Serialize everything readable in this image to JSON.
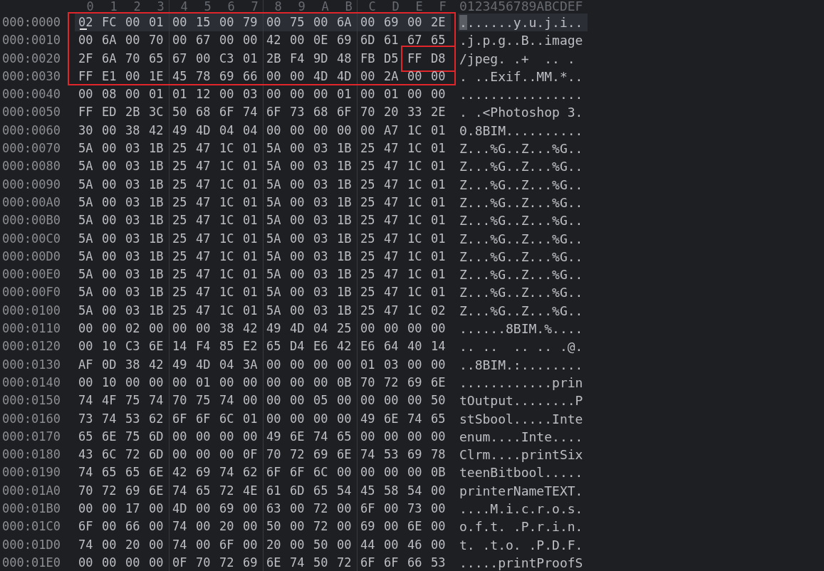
{
  "header": {
    "columns": [
      "0",
      "1",
      "2",
      "3",
      "4",
      "5",
      "6",
      "7",
      "8",
      "9",
      "A",
      "B",
      "C",
      "D",
      "E",
      "F"
    ],
    "ascii": "0123456789ABCDEF"
  },
  "rows": [
    {
      "offset": "000:0000",
      "current": true,
      "boxed": true,
      "last_pair_boxed": false,
      "bytes": [
        "02",
        "FC",
        "00",
        "01",
        "00",
        "15",
        "00",
        "79",
        "00",
        "75",
        "00",
        "6A",
        "00",
        "69",
        "00",
        "2E"
      ],
      "ascii": ".......y.u.j.i.."
    },
    {
      "offset": "000:0010",
      "current": false,
      "boxed": true,
      "last_pair_boxed": false,
      "bytes": [
        "00",
        "6A",
        "00",
        "70",
        "00",
        "67",
        "00",
        "00",
        "42",
        "00",
        "0E",
        "69",
        "6D",
        "61",
        "67",
        "65"
      ],
      "ascii": ".j.p.g..B..image"
    },
    {
      "offset": "000:0020",
      "current": false,
      "boxed": true,
      "last_pair_boxed": true,
      "bytes": [
        "2F",
        "6A",
        "70",
        "65",
        "67",
        "00",
        "C3",
        "01",
        "2B",
        "F4",
        "9D",
        "48",
        "FB",
        "D5",
        "FF",
        "D8"
      ],
      "ascii": "/jpeg. .+  .. ."
    },
    {
      "offset": "000:0030",
      "current": false,
      "boxed": true,
      "last_pair_boxed": false,
      "bytes": [
        "FF",
        "E1",
        "00",
        "1E",
        "45",
        "78",
        "69",
        "66",
        "00",
        "00",
        "4D",
        "4D",
        "00",
        "2A",
        "00",
        "00"
      ],
      "ascii": ". ..Exif..MM.*.."
    },
    {
      "offset": "000:0040",
      "current": false,
      "bytes": [
        "00",
        "08",
        "00",
        "01",
        "01",
        "12",
        "00",
        "03",
        "00",
        "00",
        "00",
        "01",
        "00",
        "01",
        "00",
        "00"
      ],
      "ascii": "................"
    },
    {
      "offset": "000:0050",
      "current": false,
      "bytes": [
        "FF",
        "ED",
        "2B",
        "3C",
        "50",
        "68",
        "6F",
        "74",
        "6F",
        "73",
        "68",
        "6F",
        "70",
        "20",
        "33",
        "2E"
      ],
      "ascii": ". .<Photoshop 3."
    },
    {
      "offset": "000:0060",
      "current": false,
      "bytes": [
        "30",
        "00",
        "38",
        "42",
        "49",
        "4D",
        "04",
        "04",
        "00",
        "00",
        "00",
        "00",
        "00",
        "A7",
        "1C",
        "01"
      ],
      "ascii": "0.8BIM.........."
    },
    {
      "offset": "000:0070",
      "current": false,
      "bytes": [
        "5A",
        "00",
        "03",
        "1B",
        "25",
        "47",
        "1C",
        "01",
        "5A",
        "00",
        "03",
        "1B",
        "25",
        "47",
        "1C",
        "01"
      ],
      "ascii": "Z...%G..Z...%G.."
    },
    {
      "offset": "000:0080",
      "current": false,
      "bytes": [
        "5A",
        "00",
        "03",
        "1B",
        "25",
        "47",
        "1C",
        "01",
        "5A",
        "00",
        "03",
        "1B",
        "25",
        "47",
        "1C",
        "01"
      ],
      "ascii": "Z...%G..Z...%G.."
    },
    {
      "offset": "000:0090",
      "current": false,
      "bytes": [
        "5A",
        "00",
        "03",
        "1B",
        "25",
        "47",
        "1C",
        "01",
        "5A",
        "00",
        "03",
        "1B",
        "25",
        "47",
        "1C",
        "01"
      ],
      "ascii": "Z...%G..Z...%G.."
    },
    {
      "offset": "000:00A0",
      "current": false,
      "bytes": [
        "5A",
        "00",
        "03",
        "1B",
        "25",
        "47",
        "1C",
        "01",
        "5A",
        "00",
        "03",
        "1B",
        "25",
        "47",
        "1C",
        "01"
      ],
      "ascii": "Z...%G..Z...%G.."
    },
    {
      "offset": "000:00B0",
      "current": false,
      "bytes": [
        "5A",
        "00",
        "03",
        "1B",
        "25",
        "47",
        "1C",
        "01",
        "5A",
        "00",
        "03",
        "1B",
        "25",
        "47",
        "1C",
        "01"
      ],
      "ascii": "Z...%G..Z...%G.."
    },
    {
      "offset": "000:00C0",
      "current": false,
      "bytes": [
        "5A",
        "00",
        "03",
        "1B",
        "25",
        "47",
        "1C",
        "01",
        "5A",
        "00",
        "03",
        "1B",
        "25",
        "47",
        "1C",
        "01"
      ],
      "ascii": "Z...%G..Z...%G.."
    },
    {
      "offset": "000:00D0",
      "current": false,
      "bytes": [
        "5A",
        "00",
        "03",
        "1B",
        "25",
        "47",
        "1C",
        "01",
        "5A",
        "00",
        "03",
        "1B",
        "25",
        "47",
        "1C",
        "01"
      ],
      "ascii": "Z...%G..Z...%G.."
    },
    {
      "offset": "000:00E0",
      "current": false,
      "bytes": [
        "5A",
        "00",
        "03",
        "1B",
        "25",
        "47",
        "1C",
        "01",
        "5A",
        "00",
        "03",
        "1B",
        "25",
        "47",
        "1C",
        "01"
      ],
      "ascii": "Z...%G..Z...%G.."
    },
    {
      "offset": "000:00F0",
      "current": false,
      "bytes": [
        "5A",
        "00",
        "03",
        "1B",
        "25",
        "47",
        "1C",
        "01",
        "5A",
        "00",
        "03",
        "1B",
        "25",
        "47",
        "1C",
        "01"
      ],
      "ascii": "Z...%G..Z...%G.."
    },
    {
      "offset": "000:0100",
      "current": false,
      "bytes": [
        "5A",
        "00",
        "03",
        "1B",
        "25",
        "47",
        "1C",
        "01",
        "5A",
        "00",
        "03",
        "1B",
        "25",
        "47",
        "1C",
        "02"
      ],
      "ascii": "Z...%G..Z...%G.."
    },
    {
      "offset": "000:0110",
      "current": false,
      "bytes": [
        "00",
        "00",
        "02",
        "00",
        "00",
        "00",
        "38",
        "42",
        "49",
        "4D",
        "04",
        "25",
        "00",
        "00",
        "00",
        "00"
      ],
      "ascii": "......8BIM.%...."
    },
    {
      "offset": "000:0120",
      "current": false,
      "bytes": [
        "00",
        "10",
        "C3",
        "6E",
        "14",
        "F4",
        "85",
        "E2",
        "65",
        "D4",
        "E6",
        "42",
        "E6",
        "64",
        "40",
        "14"
      ],
      "ascii": ".. ..  .. .. .@."
    },
    {
      "offset": "000:0130",
      "current": false,
      "bytes": [
        "AF",
        "0D",
        "38",
        "42",
        "49",
        "4D",
        "04",
        "3A",
        "00",
        "00",
        "00",
        "00",
        "01",
        "03",
        "00",
        "00"
      ],
      "ascii": "..8BIM.:........"
    },
    {
      "offset": "000:0140",
      "current": false,
      "bytes": [
        "00",
        "10",
        "00",
        "00",
        "00",
        "01",
        "00",
        "00",
        "00",
        "00",
        "00",
        "0B",
        "70",
        "72",
        "69",
        "6E"
      ],
      "ascii": "............prin"
    },
    {
      "offset": "000:0150",
      "current": false,
      "bytes": [
        "74",
        "4F",
        "75",
        "74",
        "70",
        "75",
        "74",
        "00",
        "00",
        "00",
        "05",
        "00",
        "00",
        "00",
        "00",
        "50"
      ],
      "ascii": "tOutput........P"
    },
    {
      "offset": "000:0160",
      "current": false,
      "bytes": [
        "73",
        "74",
        "53",
        "62",
        "6F",
        "6F",
        "6C",
        "01",
        "00",
        "00",
        "00",
        "00",
        "49",
        "6E",
        "74",
        "65"
      ],
      "ascii": "stSbool.....Inte"
    },
    {
      "offset": "000:0170",
      "current": false,
      "bytes": [
        "65",
        "6E",
        "75",
        "6D",
        "00",
        "00",
        "00",
        "00",
        "49",
        "6E",
        "74",
        "65",
        "00",
        "00",
        "00",
        "00"
      ],
      "ascii": "enum....Inte...."
    },
    {
      "offset": "000:0180",
      "current": false,
      "bytes": [
        "43",
        "6C",
        "72",
        "6D",
        "00",
        "00",
        "00",
        "0F",
        "70",
        "72",
        "69",
        "6E",
        "74",
        "53",
        "69",
        "78"
      ],
      "ascii": "Clrm....printSix"
    },
    {
      "offset": "000:0190",
      "current": false,
      "bytes": [
        "74",
        "65",
        "65",
        "6E",
        "42",
        "69",
        "74",
        "62",
        "6F",
        "6F",
        "6C",
        "00",
        "00",
        "00",
        "00",
        "0B"
      ],
      "ascii": "teenBitbool....."
    },
    {
      "offset": "000:01A0",
      "current": false,
      "bytes": [
        "70",
        "72",
        "69",
        "6E",
        "74",
        "65",
        "72",
        "4E",
        "61",
        "6D",
        "65",
        "54",
        "45",
        "58",
        "54",
        "00"
      ],
      "ascii": "printerNameTEXT."
    },
    {
      "offset": "000:01B0",
      "current": false,
      "bytes": [
        "00",
        "00",
        "17",
        "00",
        "4D",
        "00",
        "69",
        "00",
        "63",
        "00",
        "72",
        "00",
        "6F",
        "00",
        "73",
        "00"
      ],
      "ascii": "....M.i.c.r.o.s."
    },
    {
      "offset": "000:01C0",
      "current": false,
      "bytes": [
        "6F",
        "00",
        "66",
        "00",
        "74",
        "00",
        "20",
        "00",
        "50",
        "00",
        "72",
        "00",
        "69",
        "00",
        "6E",
        "00"
      ],
      "ascii": "o.f.t. .P.r.i.n."
    },
    {
      "offset": "000:01D0",
      "current": false,
      "bytes": [
        "74",
        "00",
        "20",
        "00",
        "74",
        "00",
        "6F",
        "00",
        "20",
        "00",
        "50",
        "00",
        "44",
        "00",
        "46",
        "00"
      ],
      "ascii": "t. .t.o. .P.D.F."
    },
    {
      "offset": "000:01E0",
      "current": false,
      "bytes": [
        "00",
        "00",
        "00",
        "00",
        "0F",
        "70",
        "72",
        "69",
        "6E",
        "74",
        "50",
        "72",
        "6F",
        "6F",
        "66",
        "53"
      ],
      "ascii": ".....printProofS"
    }
  ]
}
